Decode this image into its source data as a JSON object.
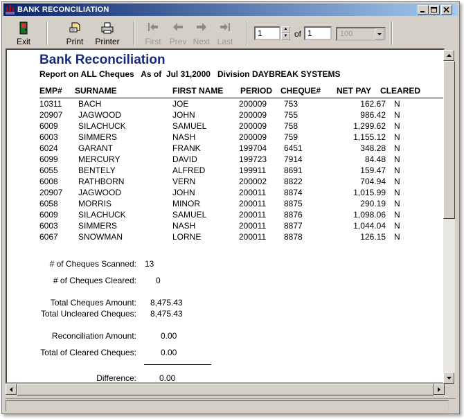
{
  "window": {
    "title": "BANK RECONCILIATION"
  },
  "toolbar": {
    "exit": "Exit",
    "print": "Print",
    "printer": "Printer",
    "first": "First",
    "prev": "Prev",
    "next": "Next",
    "last": "Last",
    "page_value": "1",
    "of_label": "of",
    "page_total": "1",
    "zoom_value": "100"
  },
  "report": {
    "title": "Bank Reconciliation",
    "subtitle": "Report on ALL Cheques   As of  Jul 31,2000   Division DAYBREAK SYSTEMS",
    "columns": [
      "EMP#",
      "SURNAME",
      "FIRST NAME",
      "PERIOD",
      "CHEQUE#",
      "NET PAY",
      "CLEARED"
    ],
    "rows": [
      {
        "emp": "10311",
        "surname": "BACH",
        "first": "JOE",
        "period": "200009",
        "cheque": "753",
        "netpay": "162.67",
        "cleared": "N"
      },
      {
        "emp": "20907",
        "surname": "JAGWOOD",
        "first": "JOHN",
        "period": "200009",
        "cheque": "755",
        "netpay": "986.42",
        "cleared": "N"
      },
      {
        "emp": "6009",
        "surname": "SILACHUCK",
        "first": "SAMUEL",
        "period": "200009",
        "cheque": "758",
        "netpay": "1,299.62",
        "cleared": "N"
      },
      {
        "emp": "6003",
        "surname": "SIMMERS",
        "first": "NASH",
        "period": "200009",
        "cheque": "759",
        "netpay": "1,155.12",
        "cleared": "N"
      },
      {
        "emp": "6024",
        "surname": "GARANT",
        "first": "FRANK",
        "period": "199704",
        "cheque": "6451",
        "netpay": "348.28",
        "cleared": "N"
      },
      {
        "emp": "6099",
        "surname": "MERCURY",
        "first": "DAVID",
        "period": "199723",
        "cheque": "7914",
        "netpay": "84.48",
        "cleared": "N"
      },
      {
        "emp": "6055",
        "surname": "BENTELY",
        "first": "ALFRED",
        "period": "199911",
        "cheque": "8691",
        "netpay": "159.47",
        "cleared": "N"
      },
      {
        "emp": "6008",
        "surname": "RATHBORN",
        "first": "VERN",
        "period": "200002",
        "cheque": "8822",
        "netpay": "704.94",
        "cleared": "N"
      },
      {
        "emp": "20907",
        "surname": "JAGWOOD",
        "first": "JOHN",
        "period": "200011",
        "cheque": "8874",
        "netpay": "1,015.99",
        "cleared": "N"
      },
      {
        "emp": "6058",
        "surname": "MORRIS",
        "first": "MINOR",
        "period": "200011",
        "cheque": "8875",
        "netpay": "290.19",
        "cleared": "N"
      },
      {
        "emp": "6009",
        "surname": "SILACHUCK",
        "first": "SAMUEL",
        "period": "200011",
        "cheque": "8876",
        "netpay": "1,098.06",
        "cleared": "N"
      },
      {
        "emp": "6003",
        "surname": "SIMMERS",
        "first": "NASH",
        "period": "200011",
        "cheque": "8877",
        "netpay": "1,044.04",
        "cleared": "N"
      },
      {
        "emp": "6067",
        "surname": "SNOWMAN",
        "first": "LORNE",
        "period": "200011",
        "cheque": "8878",
        "netpay": "126.15",
        "cleared": "N"
      }
    ]
  },
  "summary": {
    "scanned_label": "# of Cheques Scanned:",
    "scanned_value": "13",
    "cleared_label": "# of Cheques Cleared:",
    "cleared_value": "0",
    "total_amount_label": "Total Cheques Amount:",
    "total_amount_value": "8,475.43",
    "uncleared_label": "Total Uncleared Cheques:",
    "uncleared_value": "8,475.43",
    "recon_label": "Reconciliation Amount:",
    "recon_value": "0.00",
    "total_cleared_label": "Total of Cleared Cheques:",
    "total_cleared_value": "0.00",
    "difference_label": "Difference:",
    "difference_value": "0.00"
  }
}
